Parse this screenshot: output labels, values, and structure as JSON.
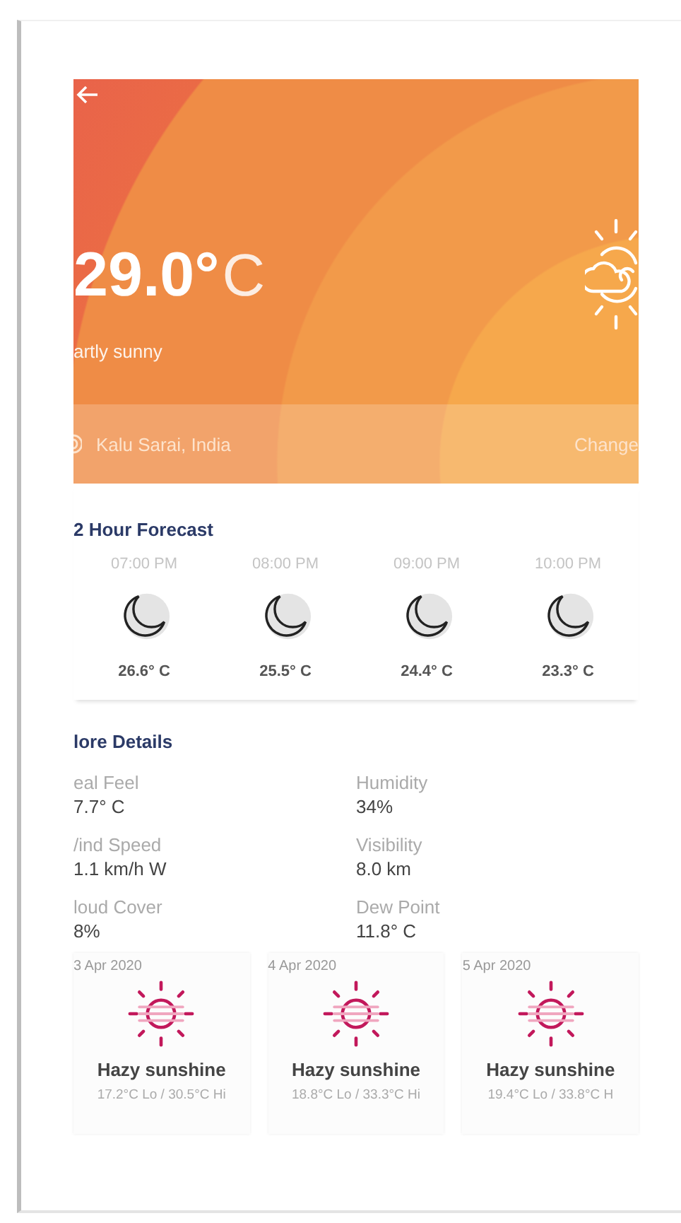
{
  "hero": {
    "temperature": "29.0°",
    "unit": "C",
    "condition": "artly sunny",
    "location": "Kalu Sarai, India",
    "action": "Change"
  },
  "hourly": {
    "title": "2 Hour Forecast",
    "items": [
      {
        "time": "07:00 PM",
        "temp": "26.6° C"
      },
      {
        "time": "08:00 PM",
        "temp": "25.5° C"
      },
      {
        "time": "09:00 PM",
        "temp": "24.4° C"
      },
      {
        "time": "10:00 PM",
        "temp": "23.3° C"
      }
    ]
  },
  "details": {
    "title": "lore Details",
    "items": [
      {
        "label": "eal Feel",
        "value": "7.7° C"
      },
      {
        "label": "Humidity",
        "value": "34%"
      },
      {
        "label": "/ind Speed",
        "value": "1.1 km/h W"
      },
      {
        "label": "Visibility",
        "value": "8.0 km"
      },
      {
        "label": "loud Cover",
        "value": "8%"
      },
      {
        "label": "Dew Point",
        "value": "11.8° C"
      }
    ]
  },
  "daily": [
    {
      "date": "3 Apr 2020",
      "condition": "Hazy sunshine",
      "range": "17.2°C Lo / 30.5°C Hi"
    },
    {
      "date": "4 Apr 2020",
      "condition": "Hazy sunshine",
      "range": "18.8°C Lo / 33.3°C Hi"
    },
    {
      "date": "5 Apr 2020",
      "condition": "Hazy sunshine",
      "range": "19.4°C Lo / 33.8°C H"
    }
  ]
}
